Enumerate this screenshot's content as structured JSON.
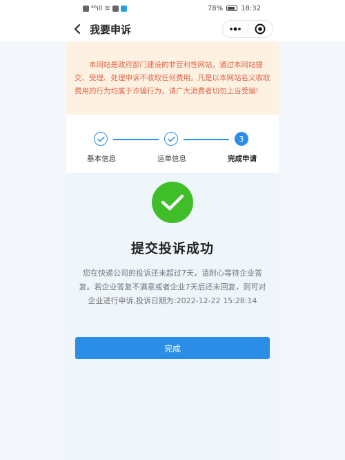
{
  "status_bar": {
    "signal_text": "⁴⁶ıll",
    "battery": "78%",
    "time": "18:32"
  },
  "nav": {
    "title": "我要申诉",
    "back_icon": "chevron-left-icon",
    "more_icon": "more-dots-icon",
    "close_icon": "close-circle-icon"
  },
  "notice": {
    "text": "本网站是政府部门建设的非营利性网站，通过本网站提交、受理、处理申诉不收取任何费用。凡是以本网站名义收取费用的行为均属于诈骗行为，请广大消费者切勿上当受骗!"
  },
  "steps": [
    {
      "label": "基本信息",
      "state": "done"
    },
    {
      "label": "运单信息",
      "state": "done"
    },
    {
      "label": "完成申请",
      "state": "active",
      "number": "3"
    }
  ],
  "result": {
    "title": "提交投诉成功",
    "description": "您在快递公司的投诉还未超过7天，请耐心等待企业答复。若企业答复不满意或者企业7天后还未回复，则可对企业进行申诉,投诉日期为:2022-12-22 15:28:14",
    "button_label": "完成"
  },
  "colors": {
    "accent": "#2a8de6",
    "success": "#3fbe2a",
    "notice_bg": "#fdf1e2",
    "notice_text": "#e0674a"
  }
}
